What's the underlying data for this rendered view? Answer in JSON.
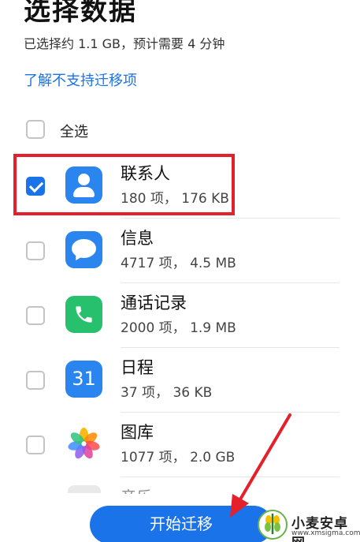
{
  "header": {
    "title": "选择数据",
    "summary": "已选择约 1.1 GB，预计需要 4 分钟",
    "unsupported_link": "了解不支持迁移项"
  },
  "select_all": {
    "label": "全选",
    "checked": false
  },
  "items": [
    {
      "name": "联系人",
      "detail": "180 项， 176 KB",
      "checked": true,
      "icon": "contacts-icon"
    },
    {
      "name": "信息",
      "detail": "4717 项， 4.5 MB",
      "checked": false,
      "icon": "messages-icon"
    },
    {
      "name": "通话记录",
      "detail": "2000 项， 1.9 MB",
      "checked": false,
      "icon": "phone-call-icon"
    },
    {
      "name": "日程",
      "detail": "37 项， 36 KB",
      "checked": false,
      "icon": "calendar-icon",
      "icon_text": "31"
    },
    {
      "name": "图库",
      "detail": "1077 项， 2.0 GB",
      "checked": false,
      "icon": "gallery-icon"
    }
  ],
  "next_item_peek": {
    "name": "音乐"
  },
  "action": {
    "start_label": "开始迁移"
  },
  "watermark": {
    "name": "小麦安卓网",
    "url": "www.xmsigma.com"
  },
  "colors": {
    "accent": "#1a73e8",
    "highlight": "#e4202c",
    "calls_green": "#27c16e"
  }
}
